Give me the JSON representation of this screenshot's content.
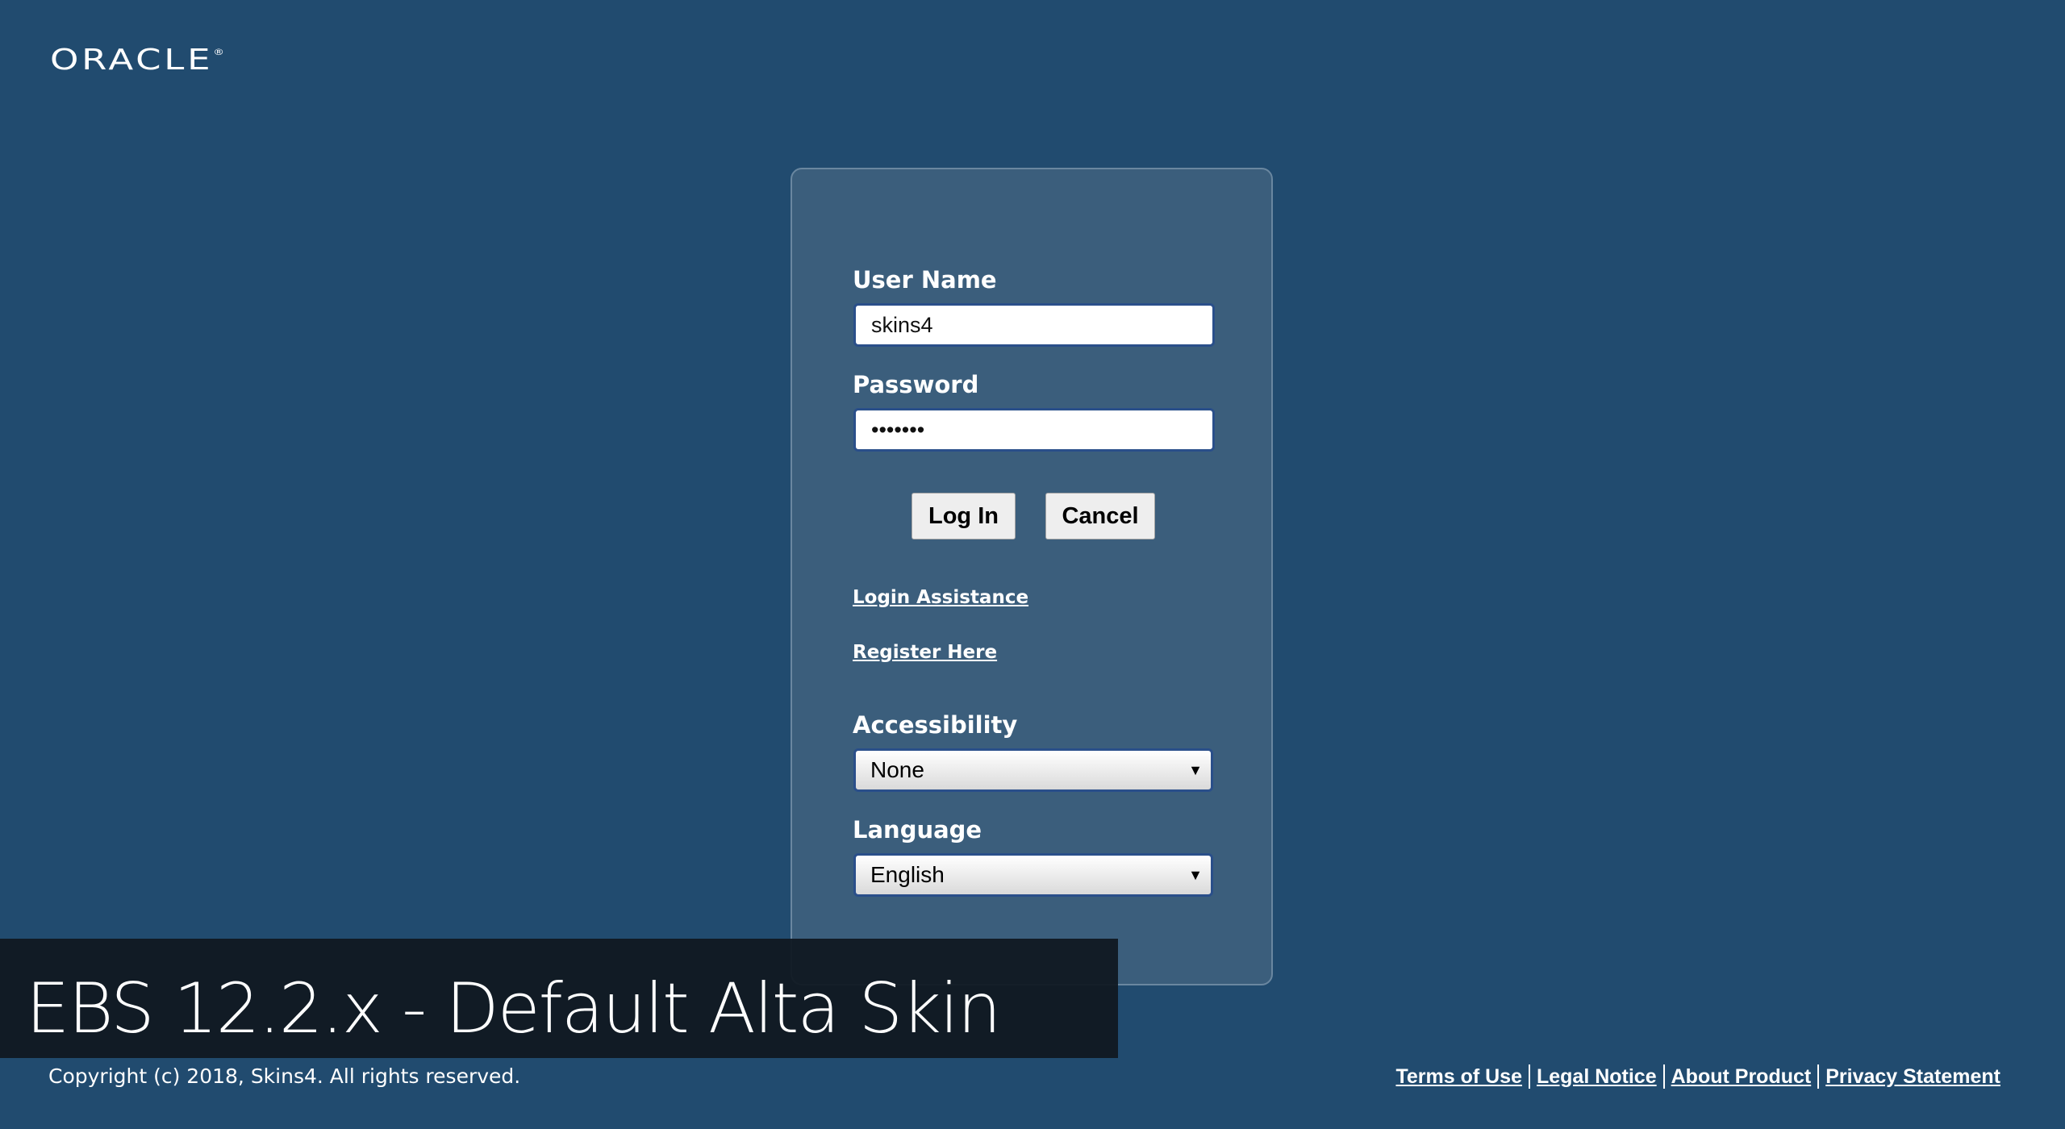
{
  "brand": {
    "logo_text": "ORACLE",
    "logo_mark": "®"
  },
  "login": {
    "username_label": "User Name",
    "username_value": "skins4",
    "password_label": "Password",
    "password_value": "•••••••",
    "login_button": "Log In",
    "cancel_button": "Cancel",
    "login_assistance_link": "Login Assistance",
    "register_link": "Register Here",
    "accessibility_label": "Accessibility",
    "accessibility_selected": "None",
    "language_label": "Language",
    "language_selected": "English"
  },
  "banner": {
    "text": "EBS 12.2.x - Default Alta Skin"
  },
  "footer": {
    "copyright": "Copyright (c) 2018, Skins4. All rights reserved.",
    "links": [
      "Terms of Use",
      "Legal Notice",
      "About Product",
      "Privacy Statement"
    ]
  },
  "icons": {
    "dropdown": "▼"
  },
  "colors": {
    "background": "#214b6f",
    "panel": "#3b5e7c",
    "input_border": "#2a4f8a",
    "banner": "#101821"
  }
}
